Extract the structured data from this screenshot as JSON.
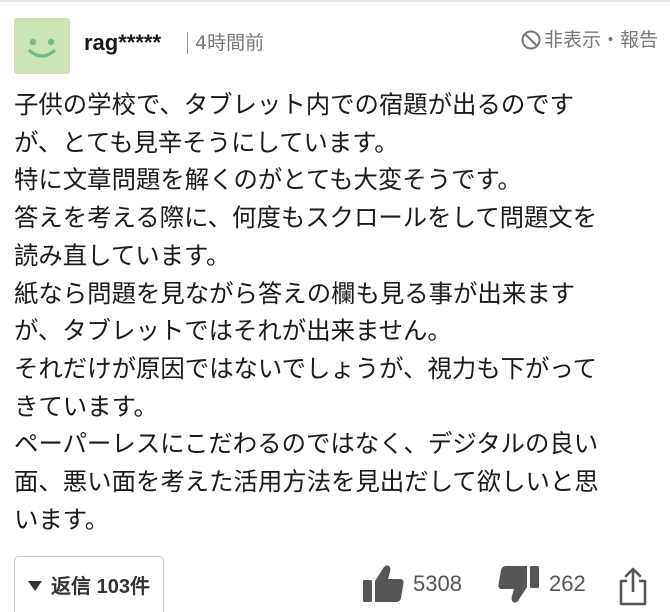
{
  "comment": {
    "avatar_icon": "smiley-face-icon",
    "avatar_color": "#cde4b4",
    "username": "rag*****",
    "posted_time": "4時間前",
    "hide_report_icon": "prohibited-icon",
    "hide_report_label": "非表示・報告",
    "body_lines": [
      "子供の学校で、タブレット内での宿題が出るのです",
      "が、とても見辛そうにしています。",
      "特に文章問題を解くのがとても大変そうです。",
      "答えを考える際に、何度もスクロールをして問題文を",
      "読み直しています。",
      "紙なら問題を見ながら答えの欄も見る事が出来ます",
      "が、タブレットではそれが出来ません。",
      "それだけが原因ではないでしょうが、視力も下がって",
      "きています。",
      "ペーパーレスにこだわるのではなく、デジタルの良い",
      "面、悪い面を考えた活用方法を見出だして欲しいと思",
      "います。"
    ]
  },
  "actions": {
    "reply_label": "返信 103件",
    "reply_icon": "caret-down-icon",
    "like_icon": "thumbs-up-icon",
    "like_count": "5308",
    "dislike_icon": "thumbs-down-icon",
    "dislike_count": "262",
    "share_icon": "share-icon"
  }
}
